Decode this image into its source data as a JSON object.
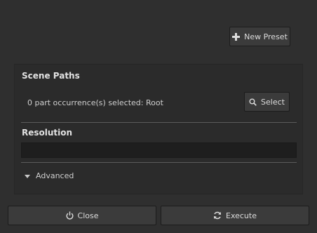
{
  "toolbar": {
    "new_preset_label": "New Preset",
    "new_preset_icon": "plus-icon"
  },
  "scene_paths": {
    "title": "Scene Paths",
    "selection_text": "0 part occurrence(s) selected: Root",
    "select_label": "Select",
    "select_icon": "search-icon"
  },
  "resolution": {
    "title": "Resolution",
    "value": ""
  },
  "advanced": {
    "label": "Advanced",
    "expanded": false
  },
  "footer": {
    "close_label": "Close",
    "close_icon": "power-icon",
    "execute_label": "Execute",
    "execute_icon": "refresh-icon"
  },
  "colors": {
    "background": "#2f2f2f",
    "panel": "#2b2b2b",
    "button": "#3b3b3b",
    "field": "#1e1e1e",
    "text": "#d0d0d0"
  }
}
